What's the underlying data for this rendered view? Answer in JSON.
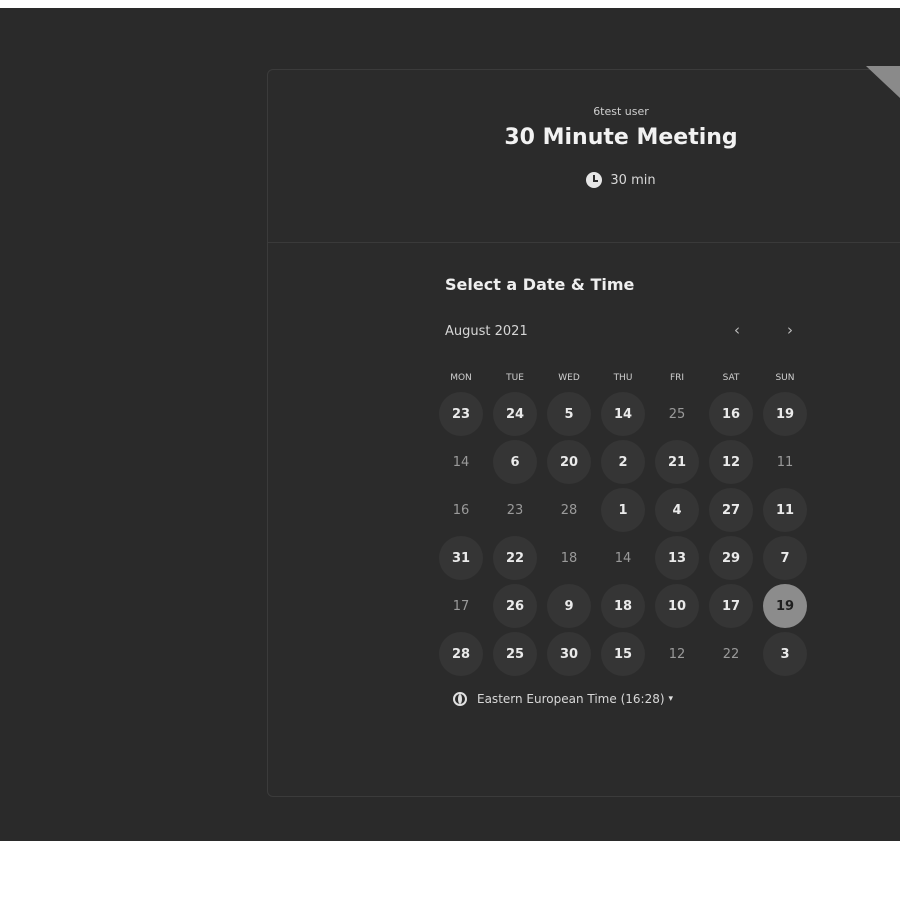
{
  "event": {
    "host": "6test user",
    "title": "30 Minute Meeting",
    "duration": "30 min",
    "duration_icon": "clock-icon"
  },
  "calendar": {
    "section_title": "Select a Date & Time",
    "month_label": "August 2021",
    "prev_label": "‹",
    "next_label": "›",
    "weekdays": [
      "MON",
      "TUE",
      "WED",
      "THU",
      "FRI",
      "SAT",
      "SUN"
    ],
    "days": [
      {
        "label": "23",
        "state": "available"
      },
      {
        "label": "24",
        "state": "available"
      },
      {
        "label": "5",
        "state": "available"
      },
      {
        "label": "14",
        "state": "available"
      },
      {
        "label": "25",
        "state": "unavailable"
      },
      {
        "label": "16",
        "state": "available"
      },
      {
        "label": "19",
        "state": "available"
      },
      {
        "label": "14",
        "state": "unavailable"
      },
      {
        "label": "6",
        "state": "available"
      },
      {
        "label": "20",
        "state": "available"
      },
      {
        "label": "2",
        "state": "available"
      },
      {
        "label": "21",
        "state": "available"
      },
      {
        "label": "12",
        "state": "available"
      },
      {
        "label": "11",
        "state": "unavailable"
      },
      {
        "label": "16",
        "state": "unavailable"
      },
      {
        "label": "23",
        "state": "unavailable"
      },
      {
        "label": "28",
        "state": "unavailable"
      },
      {
        "label": "1",
        "state": "available"
      },
      {
        "label": "4",
        "state": "available"
      },
      {
        "label": "27",
        "state": "available"
      },
      {
        "label": "11",
        "state": "available"
      },
      {
        "label": "31",
        "state": "available"
      },
      {
        "label": "22",
        "state": "available"
      },
      {
        "label": "18",
        "state": "unavailable"
      },
      {
        "label": "14",
        "state": "unavailable"
      },
      {
        "label": "13",
        "state": "available"
      },
      {
        "label": "29",
        "state": "available"
      },
      {
        "label": "7",
        "state": "available"
      },
      {
        "label": "17",
        "state": "unavailable"
      },
      {
        "label": "26",
        "state": "available"
      },
      {
        "label": "9",
        "state": "available"
      },
      {
        "label": "18",
        "state": "available"
      },
      {
        "label": "10",
        "state": "available"
      },
      {
        "label": "17",
        "state": "available"
      },
      {
        "label": "19",
        "state": "selected"
      },
      {
        "label": "28",
        "state": "available"
      },
      {
        "label": "25",
        "state": "available"
      },
      {
        "label": "30",
        "state": "available"
      },
      {
        "label": "15",
        "state": "available"
      },
      {
        "label": "12",
        "state": "unavailable"
      },
      {
        "label": "22",
        "state": "unavailable"
      },
      {
        "label": "3",
        "state": "available"
      }
    ]
  },
  "timezone": {
    "label": "Eastern European Time (16:28)",
    "icon": "globe-icon",
    "caret": "▾"
  },
  "colors": {
    "background": "#2a2a2a",
    "card": "#2b2b2b",
    "available_day": "#353535",
    "selected_day": "#8c8c8c"
  }
}
